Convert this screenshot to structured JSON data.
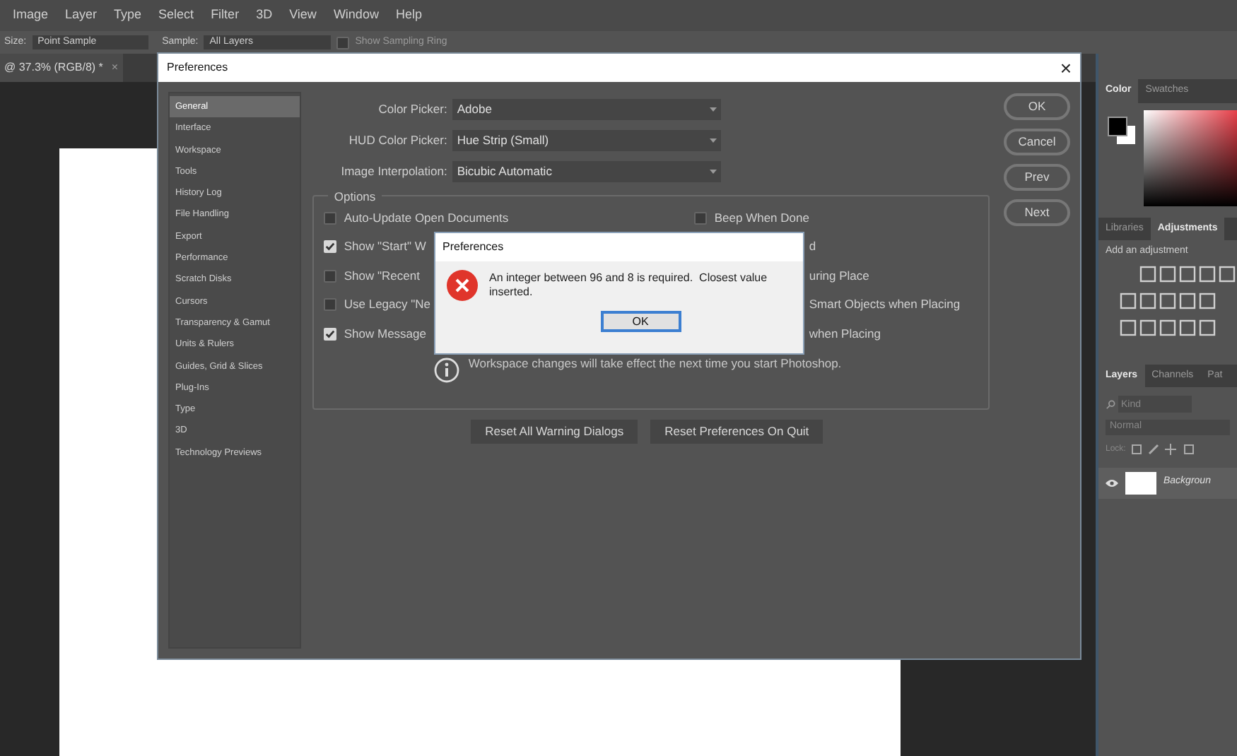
{
  "menu_bar": [
    "Image",
    "Layer",
    "Type",
    "Select",
    "Filter",
    "3D",
    "View",
    "Window",
    "Help"
  ],
  "options_bar": {
    "size_label": "Size:",
    "size_value": "Point Sample",
    "sample_label": "Sample:",
    "sample_value": "All Layers",
    "sampling_ring": "Show Sampling Ring",
    "sampling_ring_checked": false
  },
  "document_tab": {
    "title": "@ 37.3% (RGB/8) *",
    "close": "×"
  },
  "preferences": {
    "title": "Preferences",
    "close": "×",
    "sidebar": [
      {
        "label": "General",
        "selected": true
      },
      {
        "label": "Interface",
        "selected": false
      },
      {
        "label": "Workspace",
        "selected": false
      },
      {
        "label": "Tools",
        "selected": false
      },
      {
        "label": "History Log",
        "selected": false
      },
      {
        "label": "File Handling",
        "selected": false
      },
      {
        "label": "Export",
        "selected": false
      },
      {
        "label": "Performance",
        "selected": false
      },
      {
        "label": "Scratch Disks",
        "selected": false
      },
      {
        "label": "Cursors",
        "selected": false
      },
      {
        "label": "Transparency & Gamut",
        "selected": false
      },
      {
        "label": "Units & Rulers",
        "selected": false
      },
      {
        "label": "Guides, Grid & Slices",
        "selected": false
      },
      {
        "label": "Plug-Ins",
        "selected": false
      },
      {
        "label": "Type",
        "selected": false
      },
      {
        "label": "3D",
        "selected": false
      },
      {
        "label": "Technology Previews",
        "selected": false
      }
    ],
    "fields": [
      {
        "label": "Color Picker:",
        "value": "Adobe"
      },
      {
        "label": "HUD Color Picker:",
        "value": "Hue Strip (Small)"
      },
      {
        "label": "Image Interpolation:",
        "value": "Bicubic Automatic"
      }
    ],
    "options_title": "Options",
    "options": [
      {
        "left": {
          "label": "Auto-Update Open Documents",
          "checked": false
        },
        "right": {
          "label": "Beep When Done",
          "checked": false
        }
      },
      {
        "left": {
          "label": "Show \"Start\" W",
          "checked": true
        },
        "right": {
          "label": "d"
        }
      },
      {
        "left": {
          "label": "Show \"Recent",
          "checked": false
        },
        "right": {
          "label": "uring Place"
        }
      },
      {
        "left": {
          "label": "Use Legacy \"Ne",
          "checked": false
        },
        "right": {
          "label": "Smart Objects when Placing"
        }
      },
      {
        "left": {
          "label": "Show Message",
          "checked": true
        },
        "right": {
          "label": "when Placing"
        }
      }
    ],
    "info": "Workspace changes will take effect the next time you start Photoshop.",
    "reset_buttons": [
      "Reset All Warning Dialogs",
      "Reset Preferences On Quit"
    ],
    "buttons": [
      "OK",
      "Cancel",
      "Prev",
      "Next"
    ]
  },
  "alert": {
    "title": "Preferences",
    "message": "An integer between 96 and 8 is required.  Closest value inserted.",
    "button": "OK"
  },
  "panels": {
    "color_tabs": [
      {
        "label": "Color",
        "selected": true
      },
      {
        "label": "Swatches",
        "selected": false
      }
    ],
    "adjust_tabs": [
      {
        "label": "Libraries",
        "selected": false
      },
      {
        "label": "Adjustments",
        "selected": true
      }
    ],
    "adjust_hint": "Add an adjustment",
    "layer_tabs": [
      {
        "label": "Layers",
        "selected": true
      },
      {
        "label": "Channels",
        "selected": false
      },
      {
        "label": "Pat",
        "selected": false
      }
    ],
    "search_placeholder": "Kind",
    "blend_mode": "Normal",
    "lock_label": "Lock:",
    "layer_name": "Backgroun"
  }
}
